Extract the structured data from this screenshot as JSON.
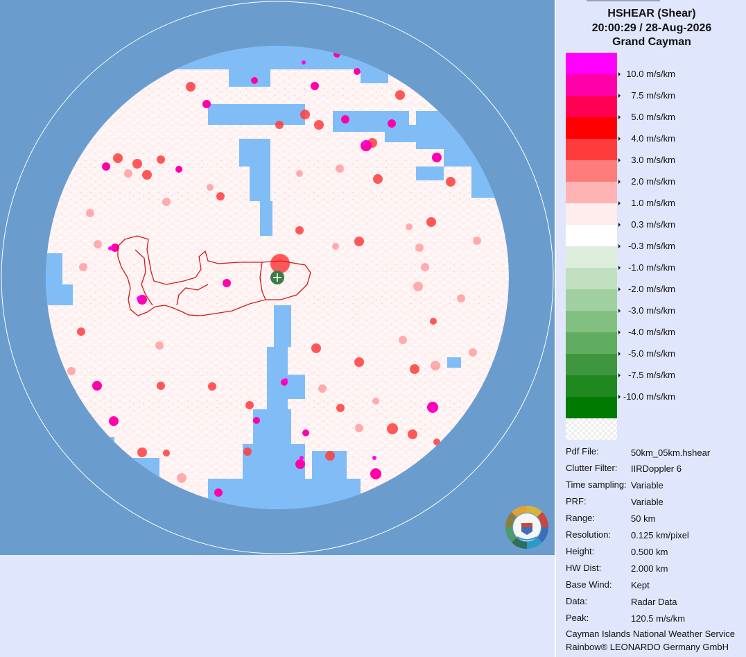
{
  "header": {
    "product": "HSHEAR (Shear)",
    "datetime": "20:00:29 / 28-Aug-2026",
    "site": "Grand Cayman"
  },
  "legend": {
    "items": [
      {
        "label": "10.0 m/s/km",
        "color": "#ff00ff"
      },
      {
        "label": "7.5 m/s/km",
        "color": "#ff00aa"
      },
      {
        "label": "5.0 m/s/km",
        "color": "#ff0055"
      },
      {
        "label": "4.0 m/s/km",
        "color": "#ff0000"
      },
      {
        "label": "3.0 m/s/km",
        "color": "#ff3c3c"
      },
      {
        "label": "2.0 m/s/km",
        "color": "#ff7c7c"
      },
      {
        "label": "1.0 m/s/km",
        "color": "#ffb4b4"
      },
      {
        "label": "0.3 m/s/km",
        "color": "#ffecec"
      },
      {
        "label": "-0.3 m/s/km",
        "color": "#ffffff"
      },
      {
        "label": "-1.0 m/s/km",
        "color": "#deeede"
      },
      {
        "label": "-2.0 m/s/km",
        "color": "#c0e0c0"
      },
      {
        "label": "-3.0 m/s/km",
        "color": "#a0d0a0"
      },
      {
        "label": "-4.0 m/s/km",
        "color": "#82c082"
      },
      {
        "label": "-5.0 m/s/km",
        "color": "#60ac60"
      },
      {
        "label": "-7.5 m/s/km",
        "color": "#3e963e"
      },
      {
        "label": "-10.0 m/s/km",
        "color": "#208820"
      }
    ],
    "bottom_color": "#007a00"
  },
  "info": [
    {
      "key": "Pdf File:",
      "value": "50km_05km.hshear"
    },
    {
      "key": "Clutter Filter:",
      "value": "IIRDoppler 6"
    },
    {
      "key": "Time sampling:",
      "value": "Variable"
    },
    {
      "key": "PRF:",
      "value": "Variable"
    },
    {
      "key": "Range:",
      "value": "50 km"
    },
    {
      "key": "Resolution:",
      "value": "0.125 km/pixel"
    },
    {
      "key": "Height:",
      "value": "0.500 km"
    },
    {
      "key": "HW Dist:",
      "value": "2.000 km"
    },
    {
      "key": "Base Wind:",
      "value": "Kept"
    },
    {
      "key": "Data:",
      "value": "Radar Data"
    },
    {
      "key": "Peak:",
      "value": "120.5 m/s/km"
    }
  ],
  "footer": {
    "line1": "Cayman Islands National Weather Service",
    "line2": "Rainbow® LEONARDO Germany GmbH"
  },
  "map": {
    "background_color": "#6a9dce",
    "noecho_color": "#80bdf7",
    "marker_icon": "radar-site-plus-icon",
    "logo_icon": "national-weather-service-logo-icon"
  }
}
